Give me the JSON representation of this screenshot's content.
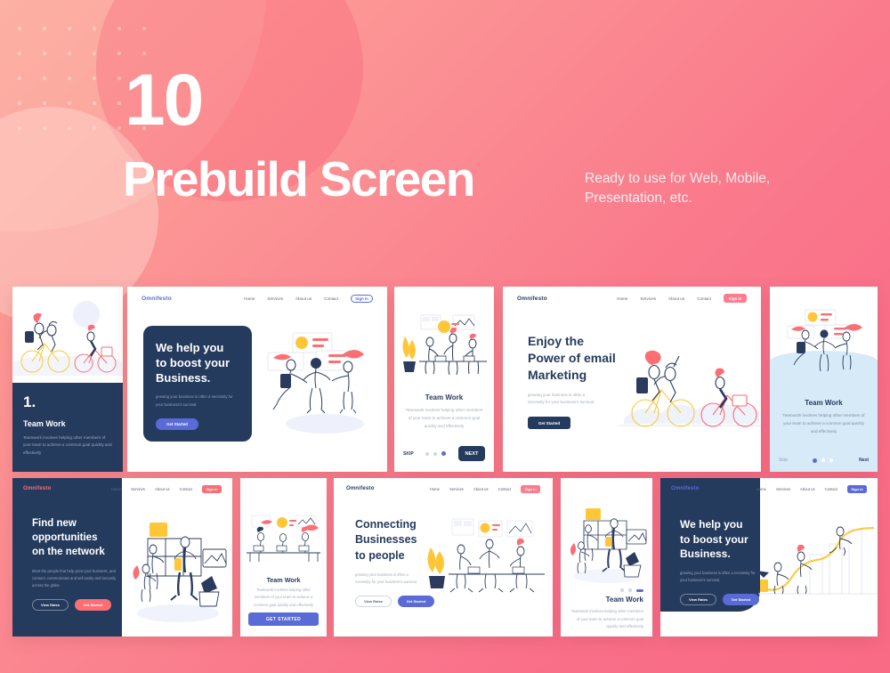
{
  "hero": {
    "number": "10",
    "title": "Prebuild Screen",
    "subtitle": "Ready to use for Web, Mobile, Presentation, etc."
  },
  "brand": "Omnifesto",
  "nav": {
    "home": "Home",
    "services": "Services",
    "about": "About us",
    "contact": "Contact",
    "signin": "Sign in"
  },
  "common": {
    "team_work_title": "Team Work",
    "team_work_body": "Teamwork involves helping other members of your team to achieve a common goal quickly and effectively",
    "growing_body": "growing your business is often a necessity for your business's survival.",
    "get_started": "Get Started",
    "view_rates": "View Rates",
    "skip_caps": "SKIP",
    "next_caps": "NEXT",
    "skip": "Skip",
    "next": "Next",
    "get_started_caps": "GET STARTED"
  },
  "colors": {
    "pink": "#f96f88",
    "navy": "#253b5e",
    "purple": "#5a6bd8",
    "yellow": "#ffc738",
    "coral": "#fb6e73",
    "lightblue": "#d6eaf8"
  },
  "cards": [
    {
      "id": "card-onboard-numbered",
      "index": "1.",
      "title": "Team Work",
      "body": "Teamwork involves helping other members of your team to achieve a common goal quickly and effectively"
    },
    {
      "id": "card-landing-boost",
      "headline_lines": [
        "We help you",
        "to boost your",
        "Business."
      ],
      "body": "growing your business is often a necessity for your business's survival.",
      "cta": "Get Started"
    },
    {
      "id": "card-onboard-teamwork-desk",
      "title": "Team Work",
      "body": "Teamwork involves helping other members of your team to achieve a common goal quickly and effectively",
      "skip": "SKIP",
      "next": "NEXT"
    },
    {
      "id": "card-landing-email",
      "headline_lines": [
        "Enjoy the",
        "Power of email",
        "Marketing"
      ],
      "body": "growing your business is often a necessity for your business's survival.",
      "cta": "Get Started"
    },
    {
      "id": "card-onboard-teamwork-blue",
      "title": "Team Work",
      "body": "Teamwork involves helping other members of your team to achieve a common goal quickly and effectively",
      "skip": "Skip",
      "next": "Next"
    },
    {
      "id": "card-landing-network",
      "headline_lines": [
        "Find new",
        "opportunities",
        "on the network"
      ],
      "body": "Meet the people that help grow your business, and connect, communicate and sell easily and securely across the globe.",
      "cta_secondary": "View Rates",
      "cta_primary": "Get Started"
    },
    {
      "id": "card-onboard-getstarted",
      "title": "Team Work",
      "body": "Teamwork involves helping other members of your team to achieve a common goal quickly and effectively",
      "cta": "GET STARTED"
    },
    {
      "id": "card-landing-connecting",
      "headline_lines": [
        "Connecting",
        "Businesses",
        "to people"
      ],
      "body": "growing your business is often a necessity for your business's survival.",
      "cta_secondary": "View Rates",
      "cta_primary": "Get Started"
    },
    {
      "id": "card-onboard-teamwork-right",
      "title": "Team Work",
      "body": "Teamwork involves helping other members of your team to achieve a common goal quickly and effectively"
    },
    {
      "id": "card-landing-boost-chart",
      "headline_lines": [
        "We help you",
        "to boost your",
        "Business."
      ],
      "body": "growing your business is often a necessity for your business's survival.",
      "cta_secondary": "View Rates",
      "cta_primary": "Get Started"
    }
  ]
}
